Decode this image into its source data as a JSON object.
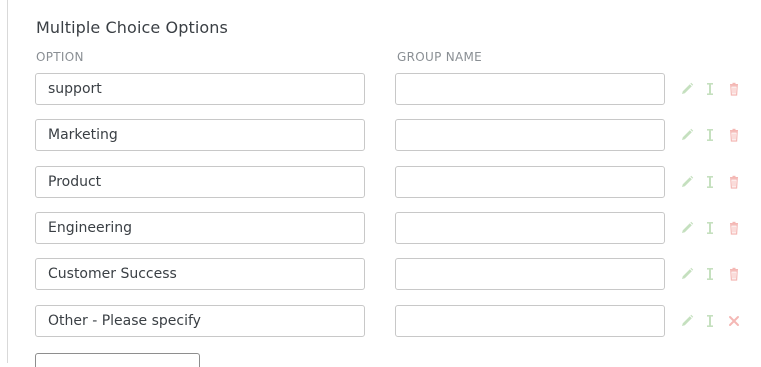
{
  "section": {
    "title": "Multiple Choice Options"
  },
  "columns": {
    "option": "OPTION",
    "group_name": "GROUP NAME"
  },
  "rows": [
    {
      "option": "support",
      "group_name": "",
      "delete_icon": "trash-icon"
    },
    {
      "option": "Marketing",
      "group_name": "",
      "delete_icon": "trash-icon"
    },
    {
      "option": "Product",
      "group_name": "",
      "delete_icon": "trash-icon"
    },
    {
      "option": "Engineering",
      "group_name": "",
      "delete_icon": "trash-icon"
    },
    {
      "option": "Customer Success",
      "group_name": "",
      "delete_icon": "trash-icon"
    },
    {
      "option": "Other - Please specify",
      "group_name": "",
      "delete_icon": "close-icon"
    }
  ],
  "icons": {
    "edit": "pencil-icon",
    "move": "reorder-icon"
  },
  "colors": {
    "action_icon": "#c5e0bf",
    "delete_icon": "#f4b8b5",
    "border": "#c8c8c8",
    "text": "#3a3f44",
    "header": "#8a8f94"
  }
}
